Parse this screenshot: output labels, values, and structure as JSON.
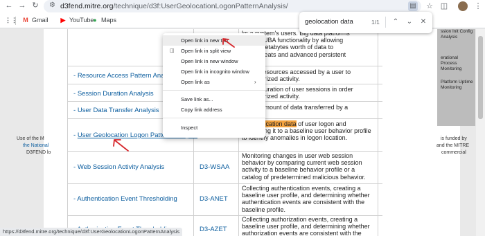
{
  "browser": {
    "url_host": "d3fend.mitre.org",
    "url_path": "/technique/d3f:UserGeolocationLogonPatternAnalysis/",
    "bookmarks": [
      {
        "label": "Gmail",
        "icon": "gmail-icon"
      },
      {
        "label": "YouTube",
        "icon": "youtube-icon"
      },
      {
        "label": "Maps",
        "icon": "maps-icon"
      }
    ],
    "status_url": "https://d3fend.mitre.org/technique/d3f:UserGeolocationLogonPatternAnalysis"
  },
  "find": {
    "query": "geolocation data",
    "count": "1/1"
  },
  "page": {
    "left_fragments": [
      "Use of the M",
      "the National",
      "D3FEND lo"
    ],
    "right_fragments": [
      "is funded by",
      "and the MITRE",
      "commercial"
    ],
    "top_desc_lines": [
      "ks a system's users. Big data platforms",
      "leasing UBA functionality by allowing",
      "nalyze petabytes worth of data to",
      "sider threats and advanced persistent"
    ],
    "side_panel": [
      "ssion Init Config Analysis",
      "erational Process Monitoring",
      "Platform Uptime Monitoring"
    ],
    "rows": [
      {
        "name": "Resource Access Pattern Analysis",
        "code": "",
        "desc": "ng the resources accessed by a user to unauthorized activity."
      },
      {
        "name": "Session Duration Analysis",
        "code": "",
        "desc": "ng the duration of user sessions in order unauthorized activity."
      },
      {
        "name": "User Data Transfer Analysis",
        "code": "",
        "desc": "ng the amount of data transferred by a"
      },
      {
        "name": "User Geolocation Logon Pattern Analysis",
        "code": "",
        "desc_pre": "ng ",
        "desc_hl": "geolocation data",
        "desc_post": " of user logon and comparing it to a baseline user behavior profile to identify anomalies in logon location."
      },
      {
        "name": "Web Session Activity Analysis",
        "code": "D3-WSAA",
        "desc": "Monitoring changes in user web session behavior by comparing current web session activity to a baseline behavior profile or a catalog of predetermined malicious behavior."
      },
      {
        "name": "Authentication Event Thresholding",
        "code": "D3-ANET",
        "desc": "Collecting authentication events, creating a baseline user profile, and determining whether authentication events are consistent with the baseline profile."
      },
      {
        "name": "Authorization Event Thresholding",
        "code": "D3-AZET",
        "desc": "Collecting authorization events, creating a baseline user profile, and determining whether authorization events are consistent with the"
      }
    ]
  },
  "context_menu": {
    "items": [
      {
        "label": "Open link in new tab",
        "icon": ""
      },
      {
        "label": "Open link in split view",
        "icon": "split-view-icon"
      },
      {
        "label": "Open link in new window",
        "icon": ""
      },
      {
        "label": "Open link in incognito window",
        "icon": ""
      },
      {
        "label": "Open link as",
        "icon": "",
        "submenu": true
      },
      {
        "label": "Save link as...",
        "icon": ""
      },
      {
        "label": "Copy link address",
        "icon": ""
      },
      {
        "label": "Inspect",
        "icon": ""
      }
    ]
  },
  "colors": {
    "link": "#0b5d9e",
    "highlight": "#f4a340",
    "annotation": "#d6262b"
  }
}
